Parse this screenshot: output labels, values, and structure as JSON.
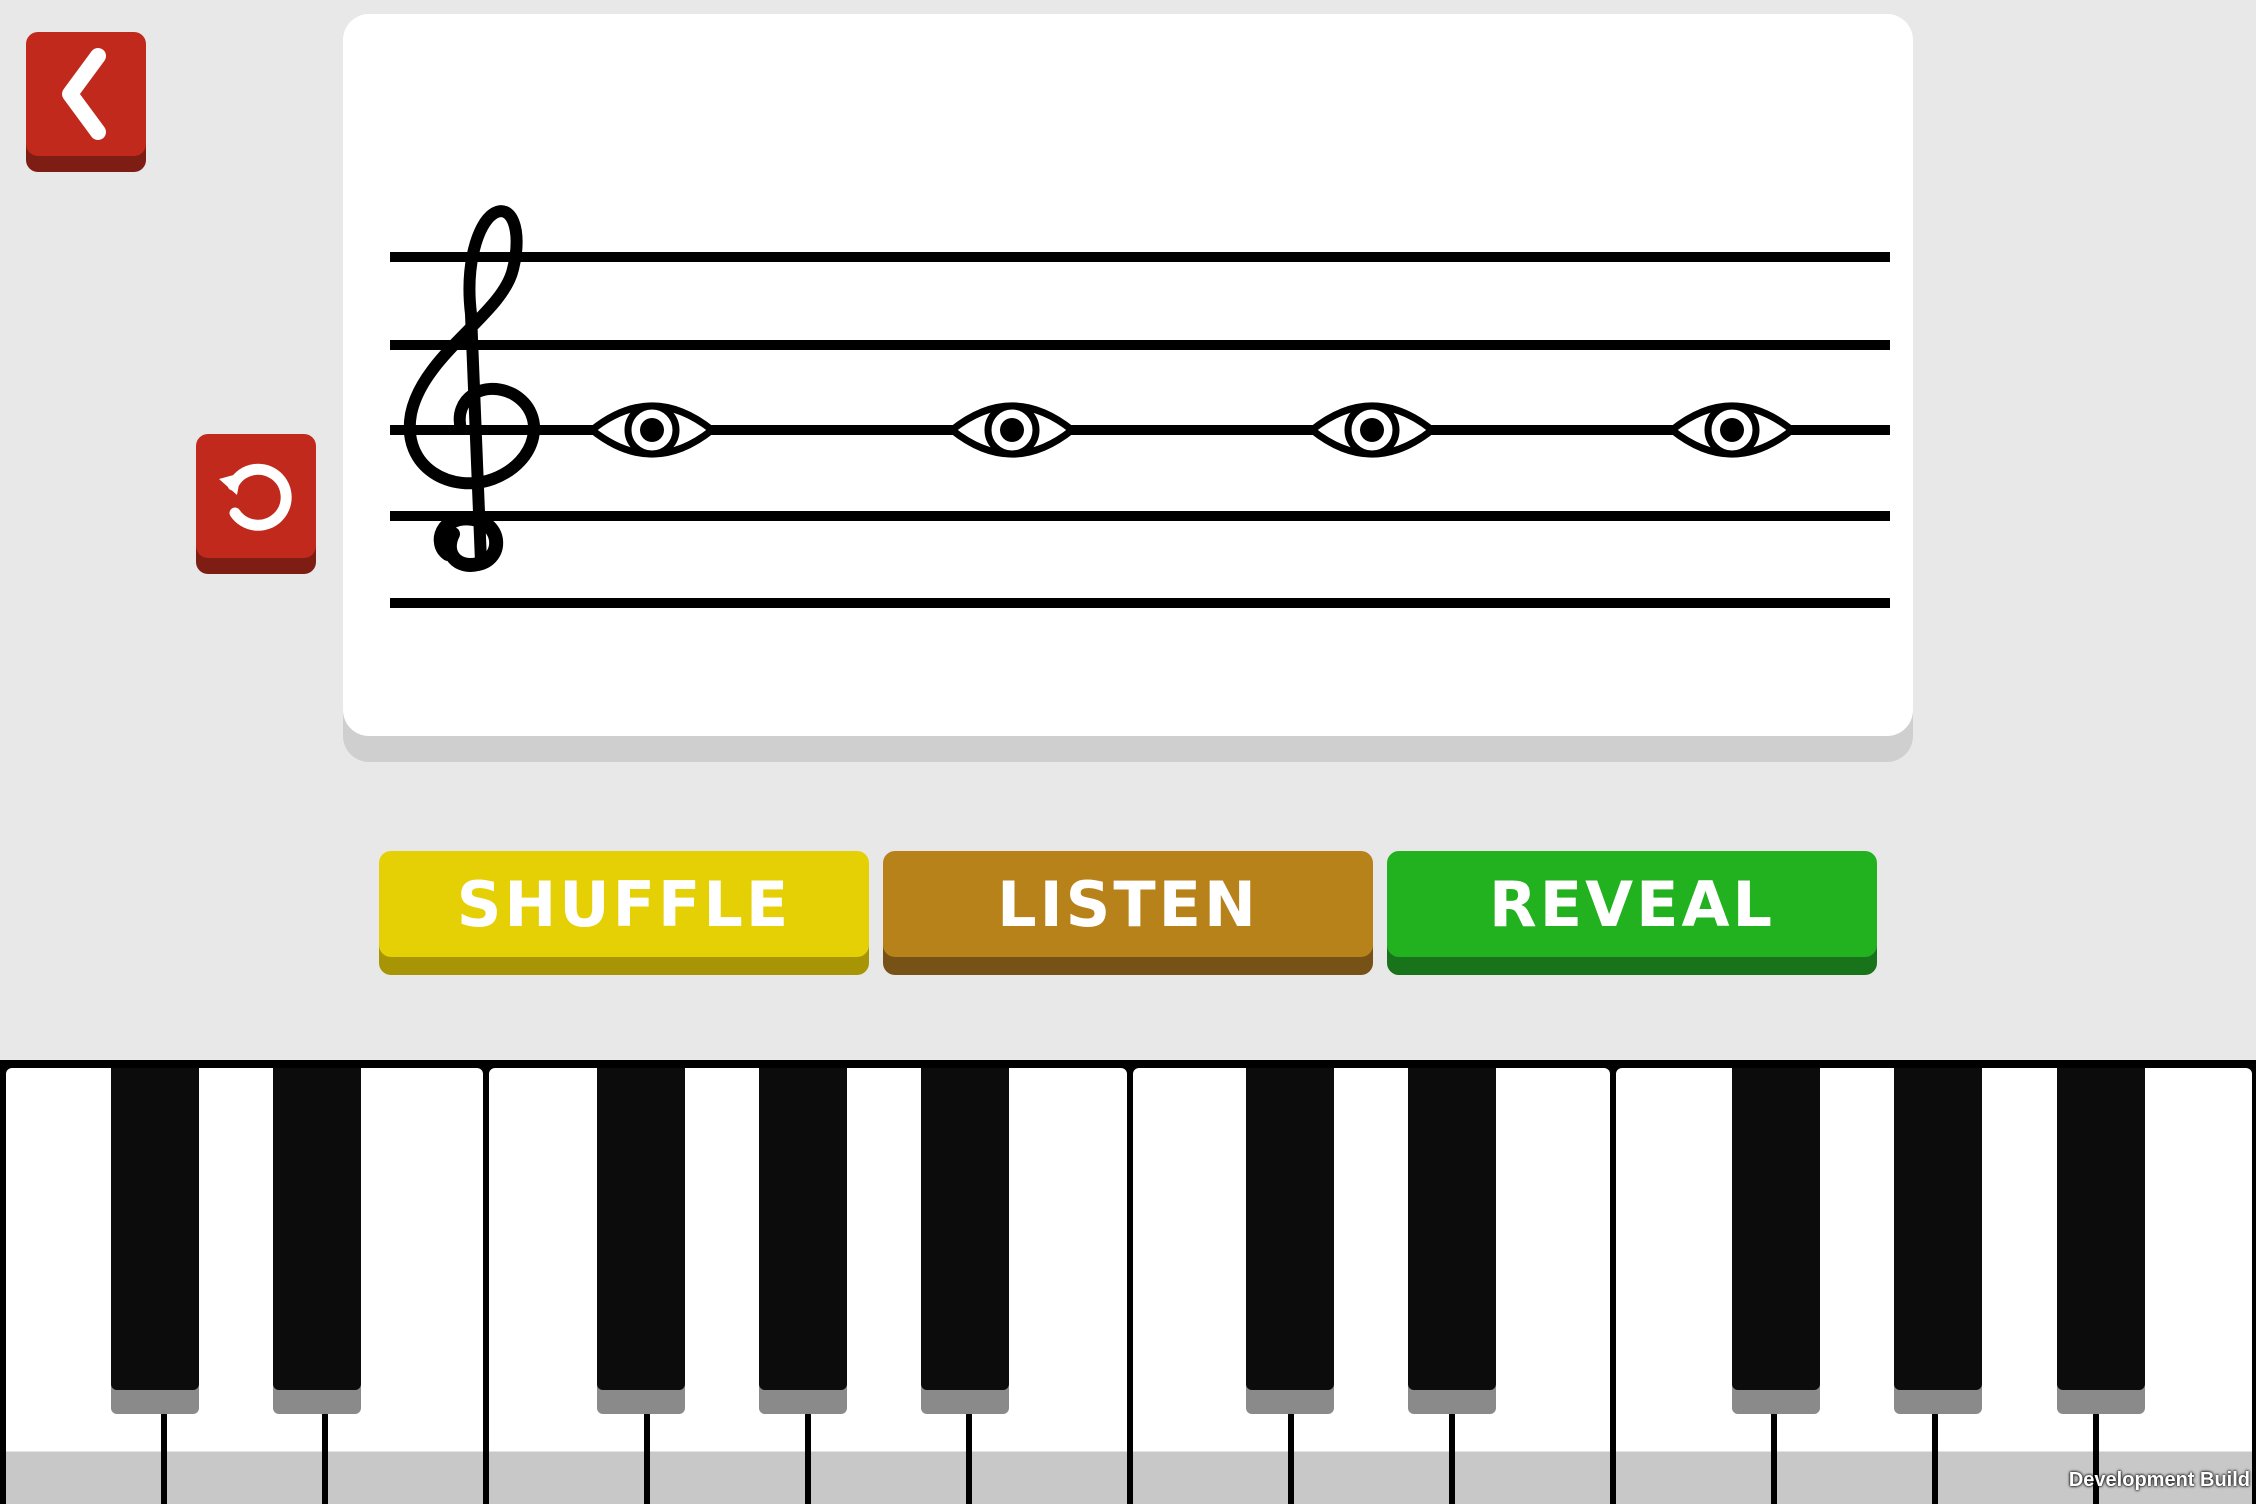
{
  "buttons": {
    "shuffle_label": "SHUFFLE",
    "listen_label": "LISTEN",
    "reveal_label": "REVEAL"
  },
  "icons": {
    "back": "chevron-left-icon",
    "reset": "rotate-ccw-icon",
    "clef": "treble-clef-icon",
    "note": "hidden-note-eye-icon"
  },
  "staff": {
    "clef": "treble",
    "lines": 5,
    "notes": [
      {
        "position": "middle-line",
        "hidden": true
      },
      {
        "position": "middle-line",
        "hidden": true
      },
      {
        "position": "middle-line",
        "hidden": true
      },
      {
        "position": "middle-line",
        "hidden": true
      }
    ]
  },
  "piano": {
    "white_keys": 14,
    "black_keys": 10
  },
  "colors": {
    "background": "#e8e8e8",
    "red_button": "#c0291b",
    "shuffle": "#e5cf05",
    "listen": "#b8821b",
    "reveal": "#23b21f"
  },
  "watermark": "Development Build"
}
